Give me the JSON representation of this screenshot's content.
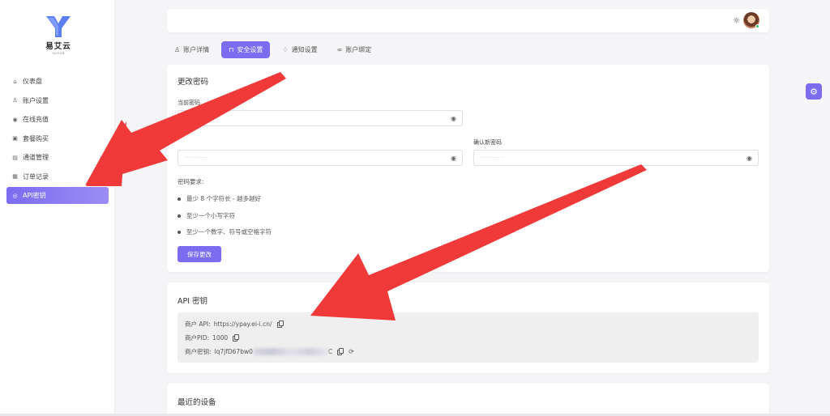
{
  "brand": {
    "name": "易艾云",
    "sub": "YAIYUN"
  },
  "sidebar": {
    "items": [
      {
        "label": "仪表盘",
        "icon": "dashboard-icon"
      },
      {
        "label": "账户设置",
        "icon": "user-icon"
      },
      {
        "label": "在线充值",
        "icon": "coin-icon"
      },
      {
        "label": "套餐购买",
        "icon": "cart-icon"
      },
      {
        "label": "通道管理",
        "icon": "channel-icon"
      },
      {
        "label": "订单记录",
        "icon": "order-icon"
      },
      {
        "label": "API密钥",
        "icon": "key-icon"
      }
    ],
    "active_index": 6
  },
  "tabs": [
    {
      "label": "账户详情",
      "icon": "user-icon"
    },
    {
      "label": "安全设置",
      "icon": "lock-icon"
    },
    {
      "label": "通知设置",
      "icon": "bell-icon"
    },
    {
      "label": "账户绑定",
      "icon": "link-icon"
    }
  ],
  "password_card": {
    "title": "更改密码",
    "current_label": "当前密码",
    "confirm_label": "确认新密码",
    "masked_new": "············",
    "masked_confirm": "············",
    "requirements_title": "密码要求:",
    "requirements": [
      "最少 8 个字符长 - 越多越好",
      "至少一个小写字符",
      "至少一个数字、符号或空格字符"
    ],
    "save_label": "保存更改"
  },
  "api_card": {
    "title": "API 密钥",
    "api_key_label": "商户 API:",
    "api_url": "https://ypay.ei-i.cn/",
    "pid_label": "商户PID:",
    "pid_value": "1000",
    "secret_label": "商户密钥:",
    "secret_value": "lq7jfD67bw0",
    "secret_tail": "C"
  },
  "devices_card": {
    "title": "最近的设备"
  },
  "colors": {
    "accent": "#7c6cf0",
    "arrow": "#f03a3a"
  }
}
